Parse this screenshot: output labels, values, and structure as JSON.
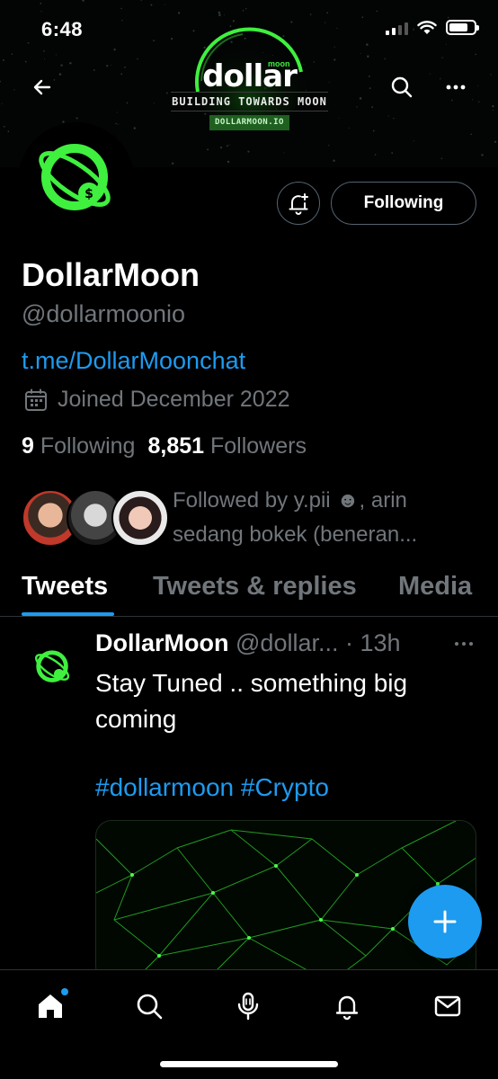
{
  "status_bar": {
    "time": "6:48"
  },
  "banner": {
    "brand_word": "dollar",
    "brand_super": "moon",
    "tagline": "BUILDING TOWARDS MOON",
    "url_badge": "DOLLARMOON.IO"
  },
  "profile": {
    "name": "DollarMoon",
    "handle": "@dollarmoonio",
    "link": "t.me/DollarMoonchat",
    "joined": "Joined December 2022",
    "following_count": "9",
    "following_label": "Following",
    "followers_count": "8,851",
    "followers_label": "Followers",
    "followed_by": "Followed by y.pii ☻, arin sedang bokek (beneran..."
  },
  "actions": {
    "following_button": "Following"
  },
  "tabs": [
    {
      "label": "Tweets",
      "active": true
    },
    {
      "label": "Tweets & replies",
      "active": false
    },
    {
      "label": "Media",
      "active": false
    }
  ],
  "tweet": {
    "name": "DollarMoon",
    "handle_time": "@dollar... · 13h",
    "text": "Stay Tuned .. something big coming",
    "hashtags": "#dollarmoon #Crypto"
  },
  "colors": {
    "accent": "#1d9bf0",
    "brand_green": "#3ff03f",
    "background": "#000000"
  }
}
